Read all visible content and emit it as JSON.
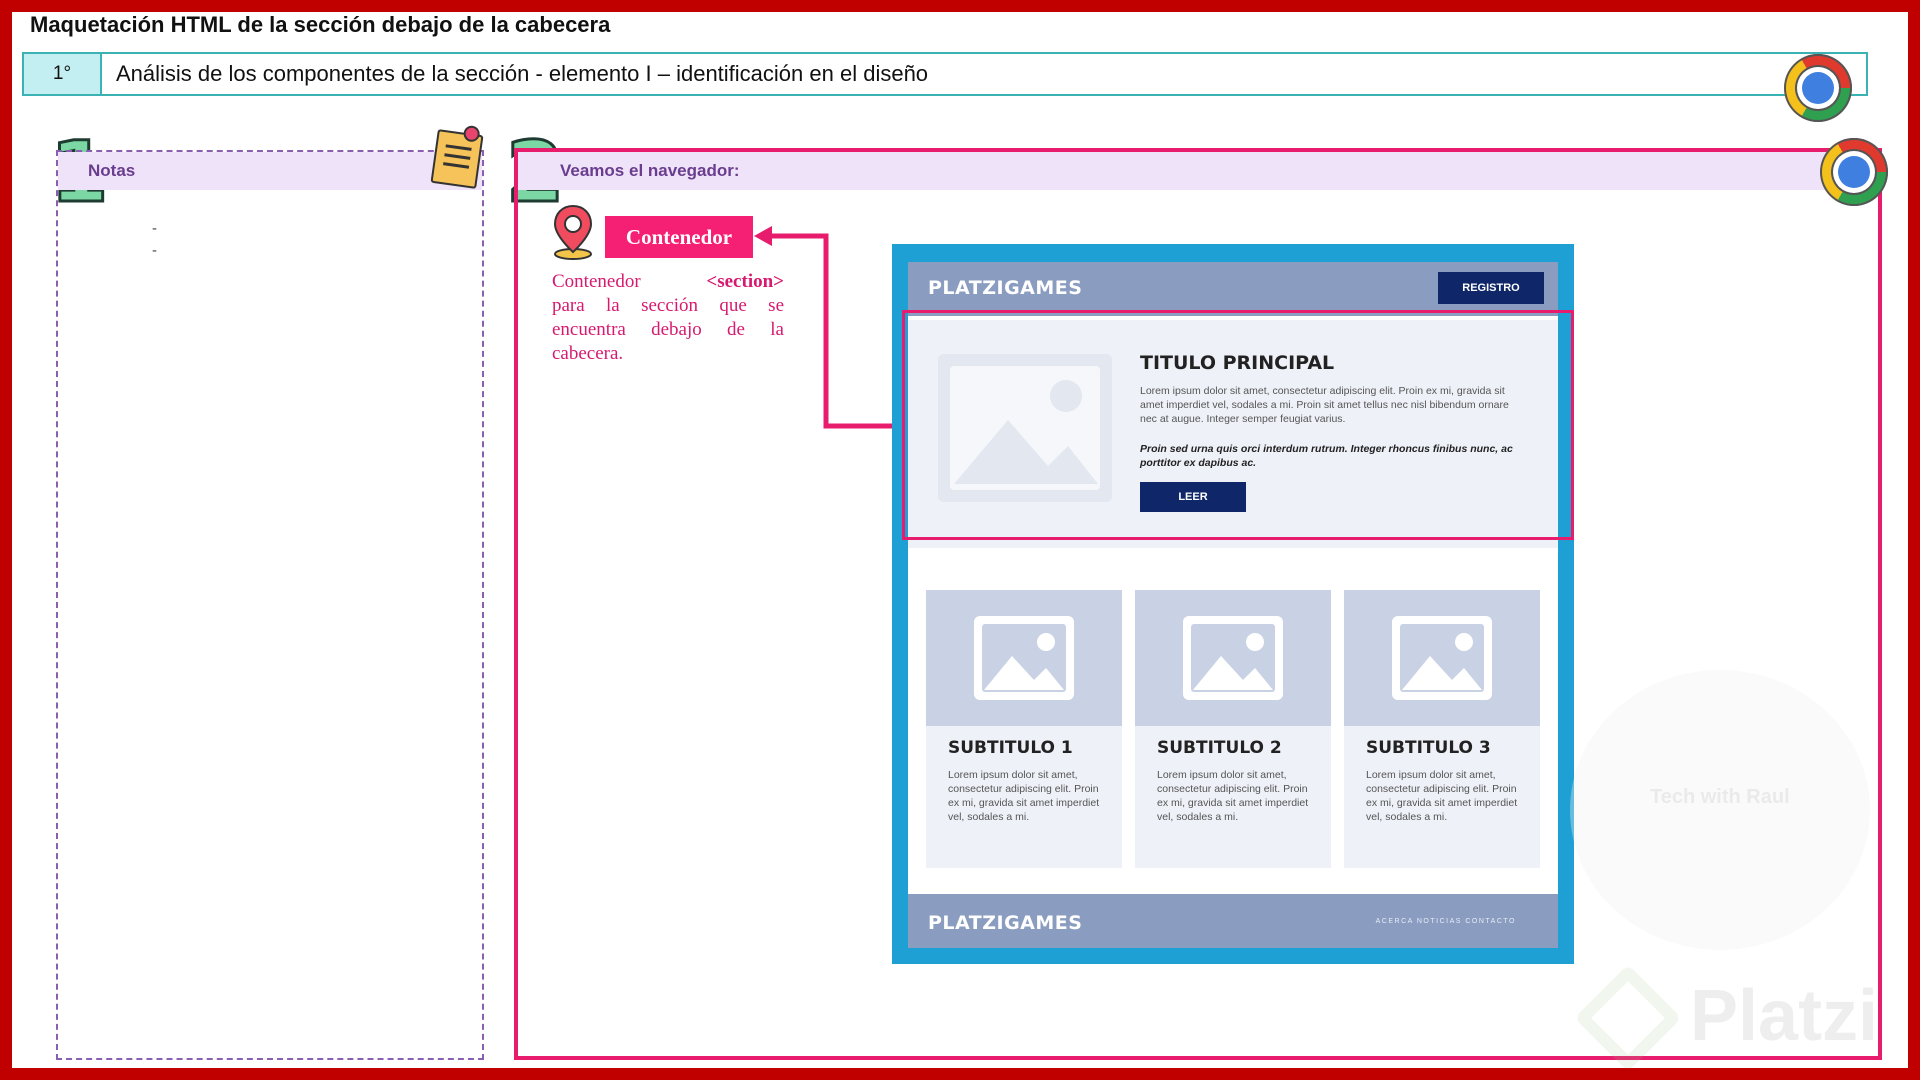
{
  "slide": {
    "title": "Maquetación HTML de la sección debajo de la cabecera",
    "step_number": "1°",
    "step_text": "Análisis de los componentes de la sección   - elemento I – identificación en el diseño"
  },
  "notes": {
    "number": "1",
    "header": "Notas",
    "items": [
      "-",
      "-"
    ]
  },
  "browser": {
    "number": "2",
    "header": "Veamos el navegador:"
  },
  "annotation": {
    "tag_label": "Contenedor",
    "desc_prefix": "Contenedor",
    "desc_tag": "<section>",
    "desc_rest": "para la sección que se encuentra debajo de la cabecera."
  },
  "mockup": {
    "logo": "PLATZIGAMES",
    "register_button": "REGISTRO",
    "hero": {
      "title": "TITULO PRINCIPAL",
      "text": "Lorem ipsum dolor sit amet, consectetur adipiscing elit. Proin ex mi, gravida sit amet imperdiet vel, sodales a mi. Proin sit amet tellus nec nisl bibendum ornare nec at augue. Integer semper feugiat varius.",
      "text_bold": "Proin sed urna quis orci interdum rutrum. Integer rhoncus finibus nunc, ac porttitor ex dapibus ac.",
      "button": "LEER"
    },
    "cards": [
      {
        "title": "SUBTITULO 1",
        "text": "Lorem ipsum dolor sit amet, consectetur adipiscing elit. Proin ex mi, gravida sit amet imperdiet vel, sodales a mi."
      },
      {
        "title": "SUBTITULO 2",
        "text": "Lorem ipsum dolor sit amet, consectetur adipiscing elit. Proin ex mi, gravida sit amet imperdiet vel, sodales a mi."
      },
      {
        "title": "SUBTITULO 3",
        "text": "Lorem ipsum dolor sit amet, consectetur adipiscing elit. Proin ex mi, gravida sit amet imperdiet vel, sodales a mi."
      }
    ],
    "footer_logo": "PLATZIGAMES",
    "footer_links": "ACERCA  NOTICIAS  CONTACTO"
  },
  "watermark": {
    "text": "Tech with Raul",
    "brand": "Platzi"
  },
  "colors": {
    "frame": "#c00000",
    "accent_pink": "#e81c6d",
    "panel_header": "#efe3f9",
    "step_border": "#3bb3b5",
    "mock_blue": "#1fa0d4",
    "mock_navy": "#0f2768"
  }
}
